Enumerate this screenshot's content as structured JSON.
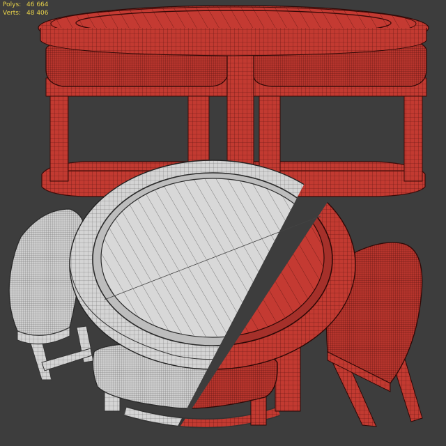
{
  "viewport": {
    "stats": {
      "polys_label": "Polys:",
      "polys_value": "46 664",
      "verts_label": "Verts:",
      "verts_value": "48 406"
    }
  },
  "colors": {
    "background": "#3d3d3d",
    "wire_red": "#c43a32",
    "wire_gray": "#d6d6d6",
    "stats_text": "#e8d24a"
  }
}
